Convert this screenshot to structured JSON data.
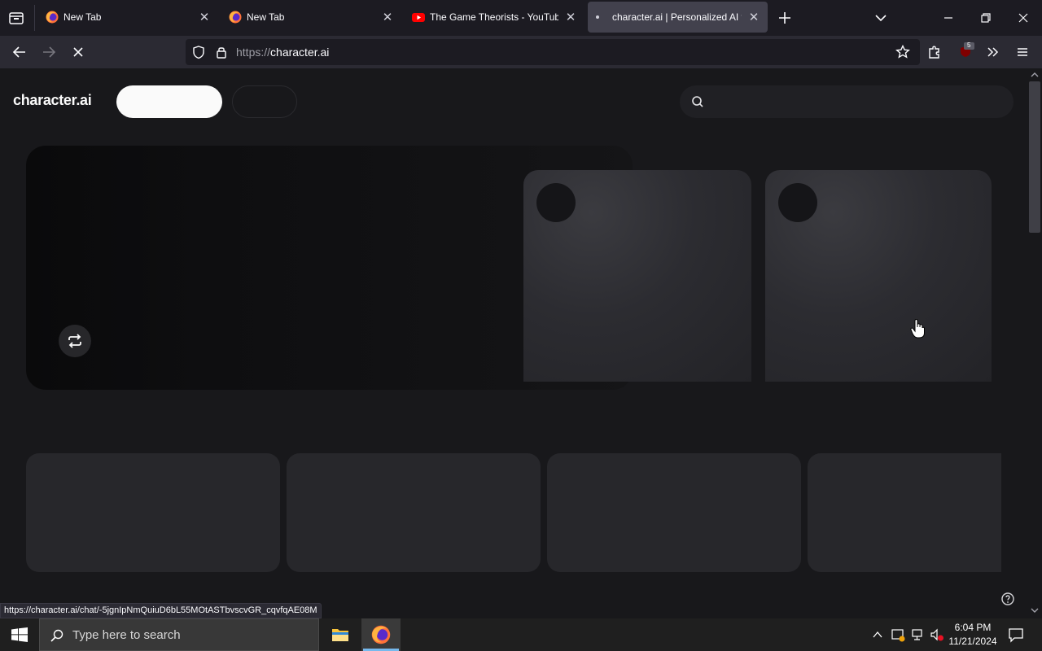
{
  "browser": {
    "tabs": [
      {
        "title": "New Tab",
        "icon": "firefox-icon",
        "active": false
      },
      {
        "title": "New Tab",
        "icon": "firefox-icon",
        "active": false
      },
      {
        "title": "The Game Theorists - YouTube",
        "icon": "youtube-icon",
        "active": false
      },
      {
        "title": "character.ai | Personalized AI fo",
        "icon": "loading-dot-icon",
        "active": true
      }
    ],
    "url_protocol": "https://",
    "url_host": "character.ai",
    "extension_badge": "5",
    "status_url": "https://character.ai/chat/-5jgnIpNmQuiuD6bL55MOtASTbvscvGR_cqvfqAE08M"
  },
  "page": {
    "logo_text": "character.ai",
    "search_placeholder": ""
  },
  "taskbar": {
    "search_placeholder": "Type here to search",
    "time": "6:04 PM",
    "date": "11/21/2024"
  },
  "colors": {
    "background": "#18181b",
    "card": "#2c2c31",
    "tab_active": "#42414d",
    "youtube_red": "#ff0000"
  }
}
